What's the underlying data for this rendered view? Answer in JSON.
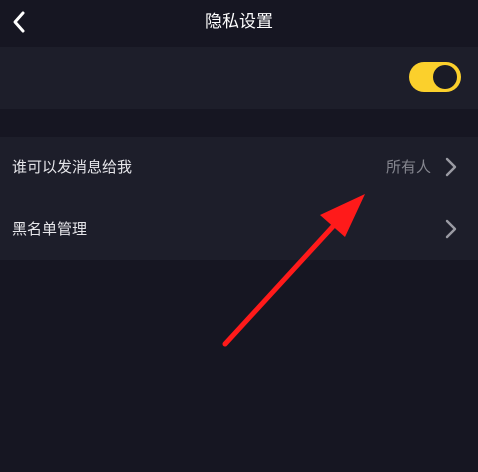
{
  "header": {
    "title": "隐私设置",
    "back_icon": "chevron-left-icon"
  },
  "toggle_row": {
    "label": "",
    "enabled": true,
    "accent": "#fbd02c"
  },
  "items": [
    {
      "label": "谁可以发消息给我",
      "value": "所有人",
      "icon": "chevron-right-icon"
    },
    {
      "label": "黑名单管理",
      "value": "",
      "icon": "chevron-right-icon"
    }
  ],
  "annotation": {
    "icon": "red-arrow-annotation",
    "color": "#ff1a1a"
  },
  "colors": {
    "background": "#161622",
    "surface": "#1d1e2a",
    "text": "#e6e6ea",
    "muted": "#85868f"
  }
}
